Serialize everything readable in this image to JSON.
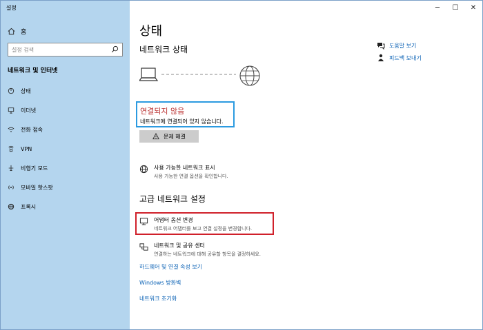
{
  "window": {
    "title": "설정",
    "minimize_glyph": "─",
    "maximize_glyph": "☐",
    "close_glyph": "✕"
  },
  "sidebar": {
    "home_label": "홈",
    "search_placeholder": "설정 검색",
    "section_title": "네트워크 및 인터넷",
    "items": [
      {
        "label": "상태",
        "icon": "status-icon"
      },
      {
        "label": "이더넷",
        "icon": "ethernet-icon"
      },
      {
        "label": "전화 접속",
        "icon": "dialup-icon"
      },
      {
        "label": "VPN",
        "icon": "vpn-icon"
      },
      {
        "label": "비행기 모드",
        "icon": "airplane-icon"
      },
      {
        "label": "모바일 핫스팟",
        "icon": "hotspot-icon"
      },
      {
        "label": "프록시",
        "icon": "proxy-icon"
      }
    ]
  },
  "main": {
    "page_title": "상태",
    "network_status_heading": "네트워크 상태",
    "connection": {
      "status_title": "연결되지 않음",
      "status_desc": "네트워크에 연결되어 있지 않습니다."
    },
    "troubleshoot_label": "문제 해결",
    "show_networks": {
      "title": "사용 가능한 네트워크 표시",
      "subtitle": "사용 가능한 연결 옵션을 확인합니다."
    },
    "advanced_heading": "고급 네트워크 설정",
    "adapter_options": {
      "title": "어댑터 옵션 변경",
      "subtitle": "네트워크 어댑터를 보고 연결 설정을 변경합니다."
    },
    "sharing_center": {
      "title": "네트워크 및 공유 센터",
      "subtitle": "연결하는 네트워크에 대해 공유할 항목을 결정하세요."
    },
    "links": {
      "hardware_props": "하드웨어 및 연결 속성 보기",
      "firewall": "Windows 방화벽",
      "reset": "네트워크 초기화"
    }
  },
  "right_panel": {
    "help": "도움말 보기",
    "feedback": "피드백 보내기"
  },
  "colors": {
    "sidebar_bg": "#b4d5ee",
    "link": "#0b62b5",
    "status_border": "#2b9ae0",
    "highlight_border": "#d0202a",
    "not_connected_text": "#b33333"
  }
}
